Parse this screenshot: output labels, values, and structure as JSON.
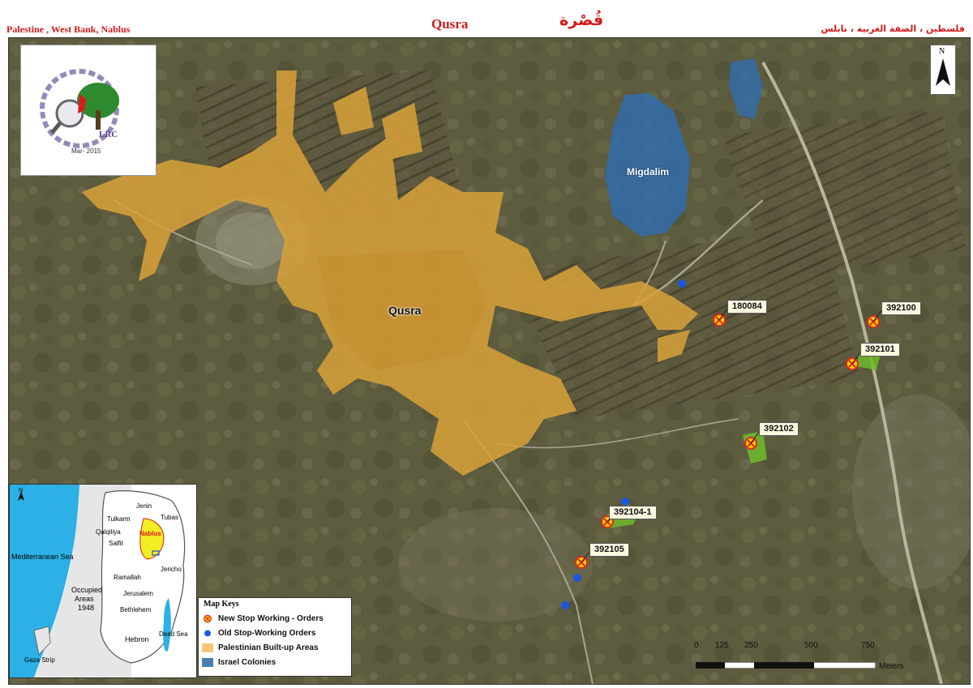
{
  "header": {
    "left": "Palestine , West Bank, Nablus",
    "title": "Qusra",
    "title_ar": "قُصْرة",
    "right_ar": "فلسطين ، الضفة الغربية ، نابلس"
  },
  "logo": {
    "text": "LRC",
    "date": "Mar- 2015"
  },
  "north": {
    "letter": "N"
  },
  "places": {
    "village": "Qusra",
    "colony": "Migdalim"
  },
  "order_labels": [
    "180084",
    "392100",
    "392101",
    "392102",
    "392104-1",
    "392105"
  ],
  "inset": {
    "north": "N",
    "sea": "Mediterranean Sea",
    "occupied": "Occupied",
    "areas": "Areas",
    "year": "1948",
    "gaza": "Gaza Strip",
    "dead_sea": "Dead Sea",
    "towns": [
      "Jenin",
      "Tubas",
      "Tulkarm",
      "Qalqiliya",
      "Nablus",
      "Salfit",
      "Jericho",
      "Ramallah",
      "Jerusalem",
      "Bethlehem",
      "Hebron"
    ]
  },
  "legend": {
    "title": "Map Keys",
    "items": [
      {
        "label": "New Stop Working - Orders",
        "kind": "new-order"
      },
      {
        "label": "Old Stop-Working Orders",
        "kind": "old-order"
      },
      {
        "label": "Palestinian Built-up Areas",
        "kind": "builtup",
        "color": "#f6c77a"
      },
      {
        "label": "Israel Colonies",
        "kind": "colony",
        "color": "#4a7fb0"
      }
    ]
  },
  "scale": {
    "ticks": [
      "0",
      "125",
      "250",
      "500",
      "750"
    ],
    "unit": "Meters"
  },
  "colors": {
    "builtup": "#d9a23a",
    "colony": "#2e6db3",
    "new_order": "#e0261e",
    "old_order": "#1a56e0",
    "agri": "#6fba2c"
  }
}
